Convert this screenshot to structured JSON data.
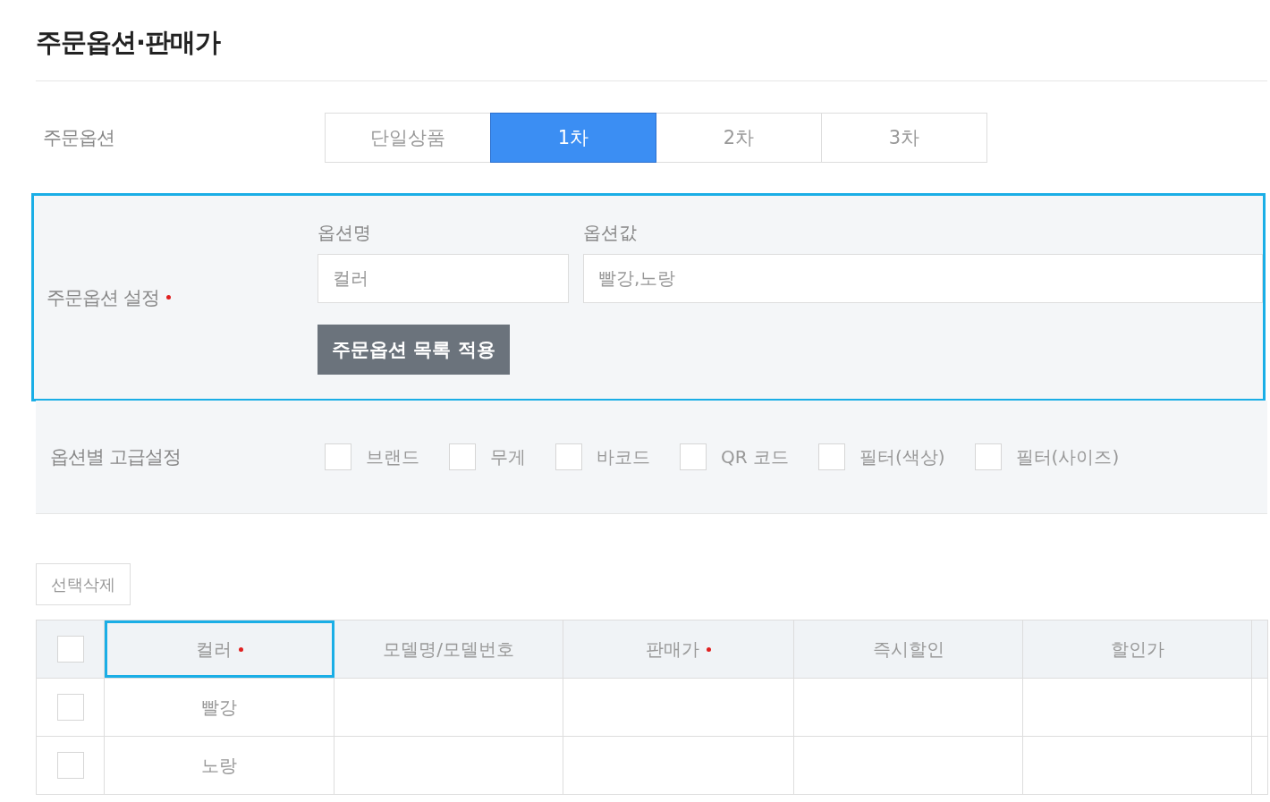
{
  "title": "주문옵션·판매가",
  "order_option": {
    "label": "주문옵션",
    "tabs": [
      {
        "label": "단일상품",
        "selected": false
      },
      {
        "label": "1차",
        "selected": true
      },
      {
        "label": "2차",
        "selected": false
      },
      {
        "label": "3차",
        "selected": false
      }
    ]
  },
  "option_setting": {
    "label": "주문옵션 설정",
    "required": true,
    "highlighted": true,
    "name_field": {
      "label": "옵션명",
      "value": "컬러"
    },
    "value_field": {
      "label": "옵션값",
      "value": "빨강,노랑"
    },
    "apply_button": "주문옵션 목록 적용"
  },
  "advanced": {
    "label": "옵션별 고급설정",
    "options": [
      {
        "label": "브랜드",
        "checked": false
      },
      {
        "label": "무게",
        "checked": false
      },
      {
        "label": "바코드",
        "checked": false
      },
      {
        "label": "QR 코드",
        "checked": false
      },
      {
        "label": "필터(색상)",
        "checked": false
      },
      {
        "label": "필터(사이즈)",
        "checked": false
      }
    ]
  },
  "delete_button": "선택삭제",
  "table": {
    "select_all": false,
    "columns": [
      {
        "label": "컬러",
        "required": true,
        "highlighted": true
      },
      {
        "label": "모델명/모델번호",
        "required": false,
        "highlighted": false
      },
      {
        "label": "판매가",
        "required": true,
        "highlighted": false
      },
      {
        "label": "즉시할인",
        "required": false,
        "highlighted": false
      },
      {
        "label": "할인가",
        "required": false,
        "highlighted": false
      }
    ],
    "rows": [
      {
        "checked": false,
        "cells": [
          "빨강"
        ]
      },
      {
        "checked": false,
        "cells": [
          "노랑"
        ]
      }
    ]
  }
}
